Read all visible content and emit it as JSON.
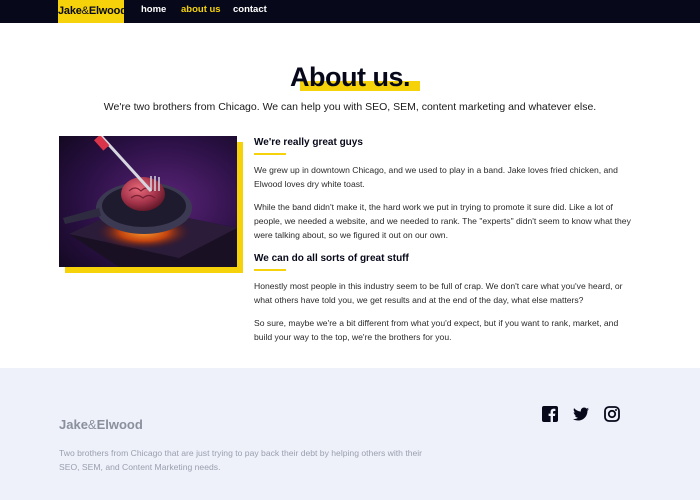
{
  "nav": {
    "logo_main": "Jake",
    "logo_amp": "&",
    "logo_end": "Elwood",
    "links": [
      "home",
      "about us",
      "contact"
    ],
    "active": "about us"
  },
  "hero": {
    "title": "About us.",
    "intro": "We're two brothers from Chicago. We can help you with SEO, SEM, content marketing and whatever else."
  },
  "section1": {
    "heading": "We're really great guys",
    "p1": "We grew up in downtown Chicago, and we used to play in a band. Jake loves fried chicken, and Elwood loves dry white toast.",
    "p2": "While the band didn't make it, the hard work we put in trying to promote it sure did. Like a lot of people, we needed a website, and we needed to rank. The \"experts\" didn't seem to know what they were talking about, so we figured it out on our own."
  },
  "section2": {
    "heading": "We can do all sorts of great stuff",
    "p1": "Honestly most people in this industry seem to be full of crap. We don't care what you've heard, or what others have told you, we get results and at the end of the day, what else matters?",
    "p2": "So sure, maybe we're a bit different from what you'd expect, but if you want to rank, market, and build your way to the top, we're the brothers for you."
  },
  "footer": {
    "logo_main": "Jake",
    "logo_amp": "&",
    "logo_end": "Elwood",
    "description": "Two brothers from Chicago that are just trying to pay back their debt by helping others with their SEO, SEM, and Content Marketing needs.",
    "social_icons": [
      "facebook-icon",
      "twitter-icon",
      "instagram-icon"
    ]
  },
  "colors": {
    "accent": "#f5d20a",
    "nav_bg": "#07091a",
    "footer_bg": "#eef1fa"
  }
}
